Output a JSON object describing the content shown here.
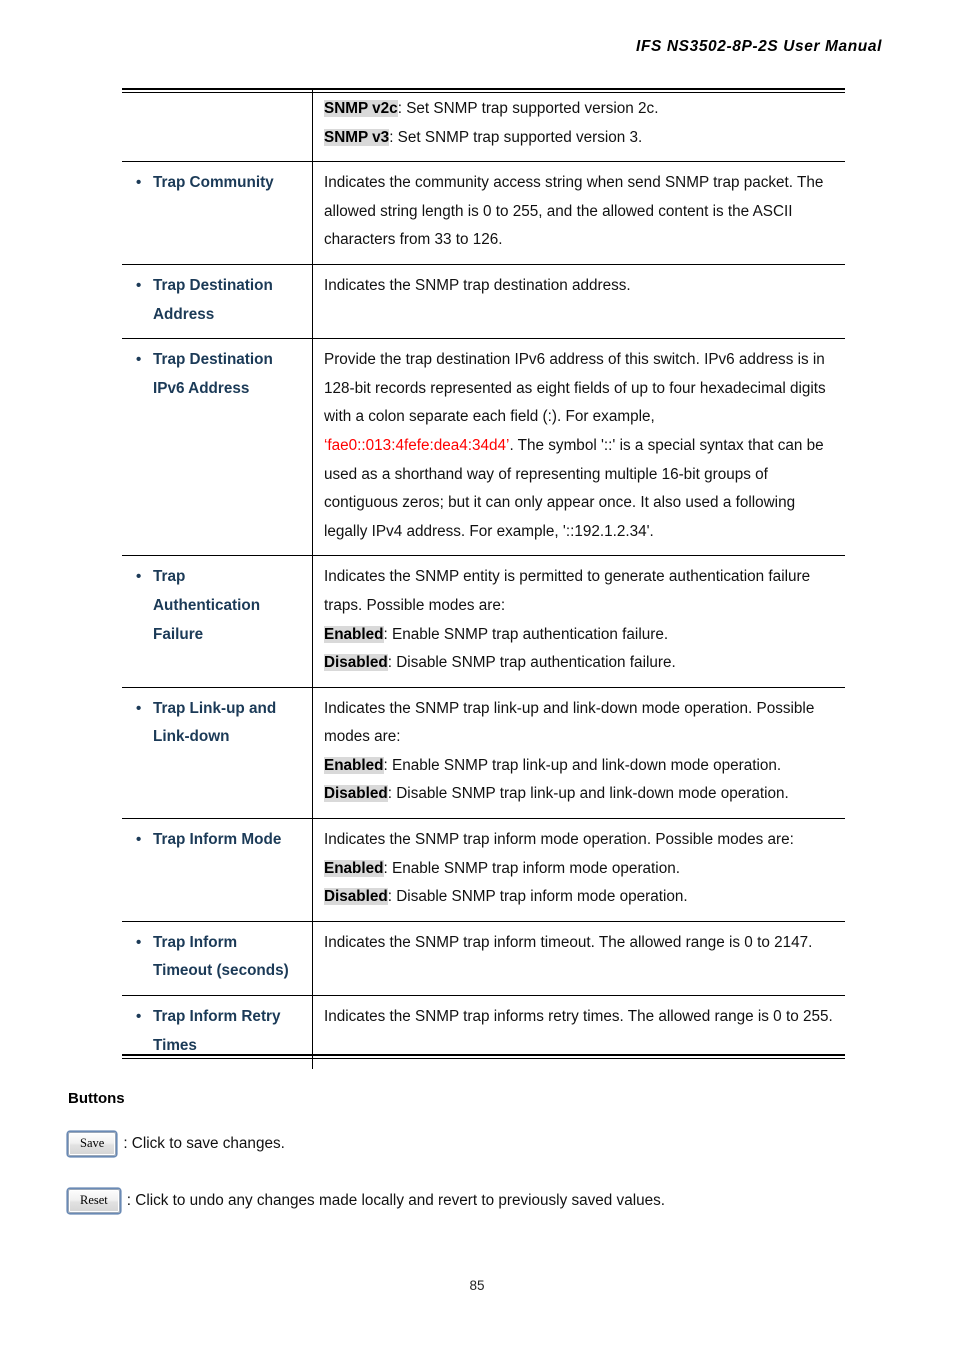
{
  "document": {
    "header_title": "IFS  NS3502-8P-2S  User  Manual",
    "page_number": "85",
    "highlight_color": "#d9d9d9",
    "label_color": "#1B3A57",
    "accent_red": "#ff0000"
  },
  "table": {
    "rows": [
      {
        "label_line1": "",
        "label_line2": "",
        "has_bullet": false,
        "description_paragraphs": [
          {
            "keyword": "SNMP v2c",
            "text": ": Set SNMP trap supported version 2c."
          },
          {
            "keyword": "SNMP v3",
            "text": ": Set SNMP trap supported version 3."
          }
        ]
      },
      {
        "label_line1": "Trap Community",
        "label_line2": "",
        "has_bullet": true,
        "description_paragraphs": [
          {
            "keyword": "",
            "text": "Indicates the community access string when send SNMP trap packet. The allowed string length is 0 to 255, and the allowed content is the ASCII characters from 33 to 126."
          }
        ]
      },
      {
        "label_line1": "Trap Destination",
        "label_line2": "Address",
        "has_bullet": true,
        "description_paragraphs": [
          {
            "keyword": "",
            "text": "Indicates the SNMP trap destination address."
          }
        ]
      },
      {
        "label_line1": "Trap Destination",
        "label_line2": "IPv6 Address",
        "has_bullet": true,
        "ipv6_paragraph": {
          "text_before": "Provide the trap destination IPv6 address of this switch. IPv6 address is in 128-bit records represented as eight fields of up to four hexadecimal digits with a colon separate each field (:). For example, ",
          "example": "‘fae0::013:4fefe:dea4:34d4’",
          "text_after": ". The symbol '::' is a special syntax that can be used as a shorthand way of representing multiple 16-bit groups of contiguous zeros; but it can only appear once. It also used a following legally IPv4 address. For example, '::192.1.2.34'."
        }
      },
      {
        "label_line1": "Trap",
        "label_line2": "Authentication",
        "label_line3": "Failure",
        "has_bullet": true,
        "description_paragraphs": [
          {
            "keyword": "",
            "text": "Indicates the SNMP entity is permitted to generate authentication failure traps. Possible modes are:"
          },
          {
            "keyword": "Enabled",
            "text": ": Enable SNMP trap authentication failure."
          },
          {
            "keyword": "Disabled",
            "text": ": Disable SNMP trap authentication failure."
          }
        ]
      },
      {
        "label_line1": "Trap Link-up and",
        "label_line2": "Link-down",
        "has_bullet": true,
        "description_paragraphs": [
          {
            "keyword": "",
            "text": "Indicates the SNMP trap link-up and link-down mode operation. Possible modes are:"
          },
          {
            "keyword": "Enabled",
            "text": ": Enable SNMP trap link-up and link-down mode operation."
          },
          {
            "keyword": "Disabled",
            "text": ": Disable SNMP trap link-up and link-down mode operation."
          }
        ]
      },
      {
        "label_line1": "Trap Inform Mode",
        "label_line2": "",
        "has_bullet": true,
        "description_paragraphs": [
          {
            "keyword": "",
            "text": "Indicates the SNMP trap inform mode operation. Possible modes are:"
          },
          {
            "keyword": "Enabled",
            "text": ": Enable SNMP trap inform mode operation."
          },
          {
            "keyword": "Disabled",
            "text": ": Disable SNMP trap inform mode operation."
          }
        ]
      },
      {
        "label_line1": "Trap Inform",
        "label_line2": "Timeout (seconds)",
        "has_bullet": true,
        "description_paragraphs": [
          {
            "keyword": "",
            "text": "Indicates the SNMP trap inform timeout. The allowed range is 0 to 2147."
          }
        ]
      },
      {
        "label_line1": "Trap Inform Retry",
        "label_line2": "Times",
        "has_bullet": true,
        "description_paragraphs": [
          {
            "keyword": "",
            "text": "Indicates the SNMP trap informs retry times. The allowed range is 0 to 255."
          }
        ]
      }
    ]
  },
  "buttons_section": {
    "heading": "Buttons",
    "save": {
      "button_label": "Save",
      "caption": ": Click to save changes."
    },
    "reset": {
      "button_label": "Reset",
      "caption": ": Click to undo any changes made locally and revert to previously saved values."
    }
  }
}
